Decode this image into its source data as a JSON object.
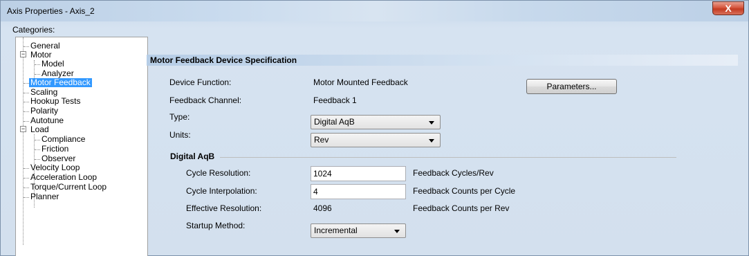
{
  "window": {
    "title": "Axis Properties - Axis_2",
    "close_label": "X"
  },
  "categories": {
    "label": "Categories:",
    "items": [
      {
        "label": "General"
      },
      {
        "label": "Motor",
        "expander": "−"
      },
      {
        "label": "Model"
      },
      {
        "label": "Analyzer"
      },
      {
        "label": "Motor Feedback",
        "selected": true
      },
      {
        "label": "Scaling"
      },
      {
        "label": "Hookup Tests"
      },
      {
        "label": "Polarity"
      },
      {
        "label": "Autotune"
      },
      {
        "label": "Load",
        "expander": "−"
      },
      {
        "label": "Compliance"
      },
      {
        "label": "Friction"
      },
      {
        "label": "Observer"
      },
      {
        "label": "Velocity Loop"
      },
      {
        "label": "Acceleration Loop"
      },
      {
        "label": "Torque/Current Loop"
      },
      {
        "label": "Planner"
      }
    ]
  },
  "panel": {
    "header": "Motor Feedback Device Specification",
    "device_function_label": "Device Function:",
    "device_function_value": "Motor Mounted Feedback",
    "parameters_button": "Parameters...",
    "feedback_channel_label": "Feedback Channel:",
    "feedback_channel_value": "Feedback 1",
    "type_label": "Type:",
    "type_value": "Digital AqB",
    "units_label": "Units:",
    "units_value": "Rev"
  },
  "digital_aqb": {
    "title": "Digital AqB",
    "cycle_resolution_label": "Cycle Resolution:",
    "cycle_resolution_value": "1024",
    "cycle_resolution_unit": "Feedback Cycles/Rev",
    "cycle_interpolation_label": "Cycle Interpolation:",
    "cycle_interpolation_value": "4",
    "cycle_interpolation_unit": "Feedback Counts per Cycle",
    "effective_resolution_label": "Effective Resolution:",
    "effective_resolution_value": "4096",
    "effective_resolution_unit": "Feedback Counts per Rev",
    "startup_method_label": "Startup Method:",
    "startup_method_value": "Incremental"
  },
  "colors": {
    "selection": "#3399ff",
    "header_gradient_start": "#b6cde6",
    "close_button": "#c33b22"
  }
}
